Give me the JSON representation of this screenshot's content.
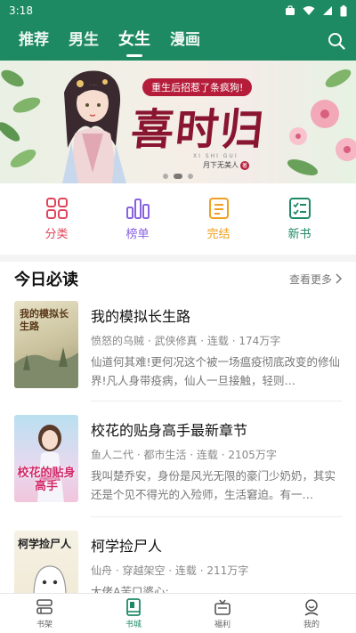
{
  "status_bar": {
    "time": "3:18"
  },
  "top_nav": {
    "tabs": [
      {
        "label": "推荐"
      },
      {
        "label": "男生"
      },
      {
        "label": "女生"
      },
      {
        "label": "漫画"
      }
    ],
    "active_tab": "女生"
  },
  "banner": {
    "tagline": "重生后招惹了条疯狗!",
    "title": "喜时归",
    "pinyin": "XI SHI GUI",
    "author": "月下无美人",
    "author_badge": "著",
    "pages": 3,
    "active_page": 1
  },
  "categories": [
    {
      "label": "分类",
      "icon": "grid-icon",
      "color": "#e0455b"
    },
    {
      "label": "榜单",
      "icon": "bar-chart-icon",
      "color": "#8a62e0"
    },
    {
      "label": "完结",
      "icon": "document-icon",
      "color": "#f0a020"
    },
    {
      "label": "新书",
      "icon": "checklist-icon",
      "color": "#1e8a64"
    }
  ],
  "section": {
    "title": "今日必读",
    "more": "查看更多"
  },
  "books": [
    {
      "title": "我的模拟长生路",
      "meta": "愤怒的乌贼 · 武侠修真 · 连载 · 174万字",
      "desc": "仙道何其难!更何况这个被一场瘟疫彻底改变的修仙界!凡人身带疫病，仙人一旦接触，轻则…",
      "cover_text": "我的模拟长生路"
    },
    {
      "title": "校花的贴身高手最新章节",
      "meta": "鱼人二代 · 都市生活 · 连载 · 2105万字",
      "desc": "我叫楚乔安，身份是风光无限的豪门少奶奶，其实还是个见不得光的入殓师，生活窘迫。有一…",
      "cover_text": "校花的贴身高手"
    },
    {
      "title": "柯学捡尸人",
      "meta": "仙舟 · 穿越架空 · 连载 · 211万字",
      "desc": "大佬A苦口婆心:",
      "cover_text": "柯学捡尸人"
    }
  ],
  "bottom_nav": {
    "items": [
      {
        "label": "书架",
        "icon": "bookshelf-icon"
      },
      {
        "label": "书城",
        "icon": "book-icon"
      },
      {
        "label": "福利",
        "icon": "tv-gift-icon"
      },
      {
        "label": "我的",
        "icon": "profile-icon"
      }
    ],
    "active": "书城",
    "accent": "#1e8a64"
  }
}
